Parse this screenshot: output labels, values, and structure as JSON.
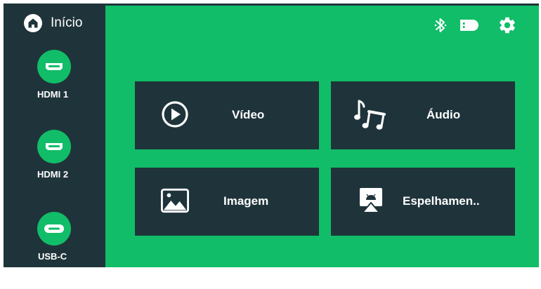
{
  "home": {
    "label": "Início",
    "icon": "home-icon"
  },
  "sources": [
    {
      "label": "HDMI 1",
      "icon": "hdmi-port-icon"
    },
    {
      "label": "HDMI 2",
      "icon": "hdmi-port-icon"
    },
    {
      "label": "USB-C",
      "icon": "usb-c-port-icon"
    }
  ],
  "status_icons": [
    "bluetooth-icon",
    "projector-icon",
    "settings-gear-icon"
  ],
  "tiles": [
    {
      "label": "Vídeo",
      "icon": "play-circle-icon"
    },
    {
      "label": "Áudio",
      "icon": "music-notes-icon"
    },
    {
      "label": "Imagem",
      "icon": "image-icon"
    },
    {
      "label": "Espelhamen..",
      "icon": "screen-mirroring-icon"
    }
  ],
  "colors": {
    "accent_green": "#11bd68",
    "dark_panel": "#1f343a",
    "text": "#ffffff"
  }
}
